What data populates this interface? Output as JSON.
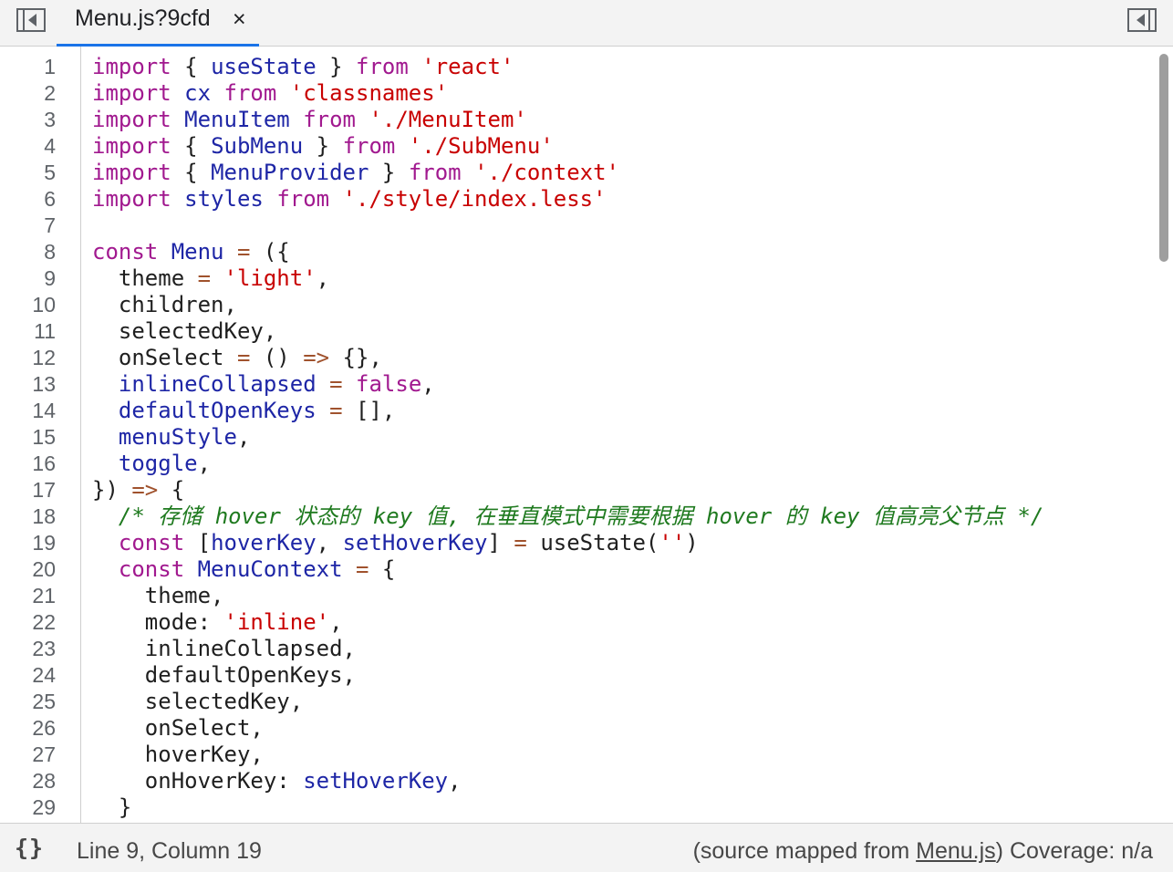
{
  "tab": {
    "label": "Menu.js?9cfd",
    "close": "×"
  },
  "toolbar": {
    "left_icon": "toggle-navigator-icon",
    "right_icon": "toggle-debugger-icon"
  },
  "editor": {
    "lines": [
      {
        "n": "1",
        "tokens": [
          [
            "kw",
            "import"
          ],
          [
            "plain",
            " { "
          ],
          [
            "var",
            "useState"
          ],
          [
            "plain",
            " } "
          ],
          [
            "kw",
            "from"
          ],
          [
            "plain",
            " "
          ],
          [
            "str",
            "'react'"
          ]
        ]
      },
      {
        "n": "2",
        "tokens": [
          [
            "kw",
            "import"
          ],
          [
            "plain",
            " "
          ],
          [
            "var",
            "cx"
          ],
          [
            "plain",
            " "
          ],
          [
            "kw",
            "from"
          ],
          [
            "plain",
            " "
          ],
          [
            "str",
            "'classnames'"
          ]
        ]
      },
      {
        "n": "3",
        "tokens": [
          [
            "kw",
            "import"
          ],
          [
            "plain",
            " "
          ],
          [
            "var",
            "MenuItem"
          ],
          [
            "plain",
            " "
          ],
          [
            "kw",
            "from"
          ],
          [
            "plain",
            " "
          ],
          [
            "str",
            "'./MenuItem'"
          ]
        ]
      },
      {
        "n": "4",
        "tokens": [
          [
            "kw",
            "import"
          ],
          [
            "plain",
            " { "
          ],
          [
            "var",
            "SubMenu"
          ],
          [
            "plain",
            " } "
          ],
          [
            "kw",
            "from"
          ],
          [
            "plain",
            " "
          ],
          [
            "str",
            "'./SubMenu'"
          ]
        ]
      },
      {
        "n": "5",
        "tokens": [
          [
            "kw",
            "import"
          ],
          [
            "plain",
            " { "
          ],
          [
            "var",
            "MenuProvider"
          ],
          [
            "plain",
            " } "
          ],
          [
            "kw",
            "from"
          ],
          [
            "plain",
            " "
          ],
          [
            "str",
            "'./context'"
          ]
        ]
      },
      {
        "n": "6",
        "tokens": [
          [
            "kw",
            "import"
          ],
          [
            "plain",
            " "
          ],
          [
            "var",
            "styles"
          ],
          [
            "plain",
            " "
          ],
          [
            "kw",
            "from"
          ],
          [
            "plain",
            " "
          ],
          [
            "str",
            "'./style/index.less'"
          ]
        ]
      },
      {
        "n": "7",
        "tokens": []
      },
      {
        "n": "8",
        "tokens": [
          [
            "kw",
            "const"
          ],
          [
            "plain",
            " "
          ],
          [
            "var",
            "Menu"
          ],
          [
            "plain",
            " "
          ],
          [
            "op",
            "="
          ],
          [
            "plain",
            " ({"
          ]
        ]
      },
      {
        "n": "9",
        "tokens": [
          [
            "plain",
            "  theme "
          ],
          [
            "op",
            "="
          ],
          [
            "plain",
            " "
          ],
          [
            "str",
            "'light'"
          ],
          [
            "plain",
            ","
          ]
        ]
      },
      {
        "n": "10",
        "tokens": [
          [
            "plain",
            "  children,"
          ]
        ]
      },
      {
        "n": "11",
        "tokens": [
          [
            "plain",
            "  selectedKey,"
          ]
        ]
      },
      {
        "n": "12",
        "tokens": [
          [
            "plain",
            "  onSelect "
          ],
          [
            "op",
            "="
          ],
          [
            "plain",
            " () "
          ],
          [
            "op",
            "=>"
          ],
          [
            "plain",
            " {},"
          ]
        ]
      },
      {
        "n": "13",
        "tokens": [
          [
            "plain",
            "  "
          ],
          [
            "var",
            "inlineCollapsed"
          ],
          [
            "plain",
            " "
          ],
          [
            "op",
            "="
          ],
          [
            "plain",
            " "
          ],
          [
            "kw",
            "false"
          ],
          [
            "plain",
            ","
          ]
        ]
      },
      {
        "n": "14",
        "tokens": [
          [
            "plain",
            "  "
          ],
          [
            "var",
            "defaultOpenKeys"
          ],
          [
            "plain",
            " "
          ],
          [
            "op",
            "="
          ],
          [
            "plain",
            " [],"
          ]
        ]
      },
      {
        "n": "15",
        "tokens": [
          [
            "plain",
            "  "
          ],
          [
            "var",
            "menuStyle"
          ],
          [
            "plain",
            ","
          ]
        ]
      },
      {
        "n": "16",
        "tokens": [
          [
            "plain",
            "  "
          ],
          [
            "var",
            "toggle"
          ],
          [
            "plain",
            ","
          ]
        ]
      },
      {
        "n": "17",
        "tokens": [
          [
            "plain",
            "}) "
          ],
          [
            "op",
            "=>"
          ],
          [
            "plain",
            " {"
          ]
        ]
      },
      {
        "n": "18",
        "tokens": [
          [
            "plain",
            "  "
          ],
          [
            "com",
            "/* 存储 hover 状态的 key 值, 在垂直模式中需要根据 hover 的 key 值高亮父节点 */"
          ]
        ]
      },
      {
        "n": "19",
        "tokens": [
          [
            "plain",
            "  "
          ],
          [
            "kw",
            "const"
          ],
          [
            "plain",
            " ["
          ],
          [
            "var",
            "hoverKey"
          ],
          [
            "plain",
            ", "
          ],
          [
            "var",
            "setHoverKey"
          ],
          [
            "plain",
            "] "
          ],
          [
            "op",
            "="
          ],
          [
            "plain",
            " useState("
          ],
          [
            "str",
            "''"
          ],
          [
            "plain",
            ")"
          ]
        ]
      },
      {
        "n": "20",
        "tokens": [
          [
            "plain",
            "  "
          ],
          [
            "kw",
            "const"
          ],
          [
            "plain",
            " "
          ],
          [
            "var",
            "MenuContext"
          ],
          [
            "plain",
            " "
          ],
          [
            "op",
            "="
          ],
          [
            "plain",
            " {"
          ]
        ]
      },
      {
        "n": "21",
        "tokens": [
          [
            "plain",
            "    theme,"
          ]
        ]
      },
      {
        "n": "22",
        "tokens": [
          [
            "plain",
            "    mode: "
          ],
          [
            "str",
            "'inline'"
          ],
          [
            "plain",
            ","
          ]
        ]
      },
      {
        "n": "23",
        "tokens": [
          [
            "plain",
            "    inlineCollapsed,"
          ]
        ]
      },
      {
        "n": "24",
        "tokens": [
          [
            "plain",
            "    defaultOpenKeys,"
          ]
        ]
      },
      {
        "n": "25",
        "tokens": [
          [
            "plain",
            "    selectedKey,"
          ]
        ]
      },
      {
        "n": "26",
        "tokens": [
          [
            "plain",
            "    onSelect,"
          ]
        ]
      },
      {
        "n": "27",
        "tokens": [
          [
            "plain",
            "    hoverKey,"
          ]
        ]
      },
      {
        "n": "28",
        "tokens": [
          [
            "plain",
            "    onHoverKey: "
          ],
          [
            "var",
            "setHoverKey"
          ],
          [
            "plain",
            ","
          ]
        ]
      },
      {
        "n": "29",
        "tokens": [
          [
            "plain",
            "  }"
          ]
        ]
      }
    ]
  },
  "status": {
    "pretty_print": "{}",
    "cursor": "Line 9, Column 19",
    "source_prefix": "(source mapped from ",
    "source_link": "Menu.js",
    "source_suffix": ")",
    "coverage": "Coverage: n/a"
  }
}
